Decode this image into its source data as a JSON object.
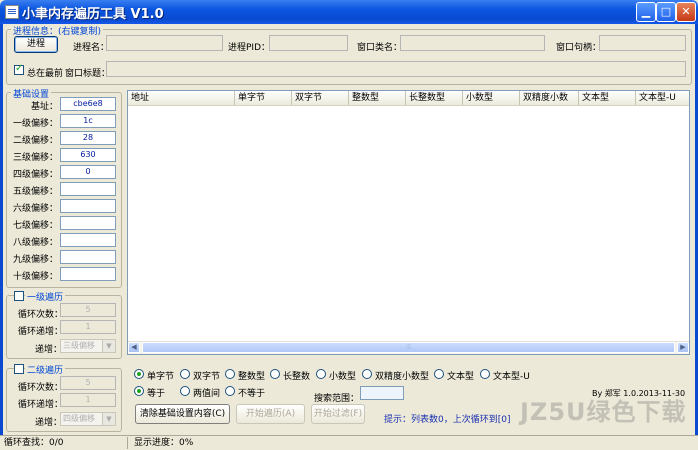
{
  "window": {
    "title": "小聿内存遍历工具  V1.0",
    "min_icon": "minimize-icon",
    "max_icon": "maximize-icon",
    "close_icon": "close-icon"
  },
  "process": {
    "group_label": "进程信息：(右键复制)",
    "process_button": "进程",
    "process_name_label": "进程名：",
    "process_name_value": "",
    "pid_label": "进程PID：",
    "pid_value": "",
    "window_class_label": "窗口类名：",
    "window_class_value": "",
    "window_handle_label": "窗口句柄：",
    "window_handle_value": "",
    "always_on_top_label": "总在最前",
    "always_on_top_checked": true,
    "window_title_label": "窗口标题：",
    "window_title_value": ""
  },
  "base": {
    "group_label": "基础设置",
    "rows": [
      {
        "label": "基址：",
        "value": "cbe6e8"
      },
      {
        "label": "一级偏移：",
        "value": "1c"
      },
      {
        "label": "二级偏移：",
        "value": "28"
      },
      {
        "label": "三级偏移：",
        "value": "630"
      },
      {
        "label": "四级偏移：",
        "value": "0"
      },
      {
        "label": "五级偏移：",
        "value": ""
      },
      {
        "label": "六级偏移：",
        "value": ""
      },
      {
        "label": "七级偏移：",
        "value": ""
      },
      {
        "label": "八级偏移：",
        "value": ""
      },
      {
        "label": "九级偏移：",
        "value": ""
      },
      {
        "label": "十级偏移：",
        "value": ""
      }
    ]
  },
  "loop1": {
    "group_label": "一级遍历",
    "count_label": "循环次数：",
    "count_value": "5",
    "step_label": "循环递增：",
    "step_value": "1",
    "inc_label": "递增：",
    "inc_value": "三级偏移"
  },
  "loop2": {
    "group_label": "二级遍历",
    "count_label": "循环次数：",
    "count_value": "5",
    "step_label": "循环递增：",
    "step_value": "1",
    "inc_label": "递增：",
    "inc_value": "四级偏移"
  },
  "table": {
    "columns": [
      "地址",
      "单字节",
      "双字节",
      "整数型",
      "长整数型",
      "小数型",
      "双精度小数",
      "文本型",
      "文本型-U"
    ]
  },
  "types": {
    "options": [
      "单字节",
      "双字节",
      "整数型",
      "长整数",
      "小数型",
      "双精度小数型",
      "文本型",
      "文本型-U"
    ],
    "selected": 0
  },
  "compare": {
    "options": [
      "等于",
      "两值间",
      "不等于"
    ],
    "selected": 0,
    "search_range_label": "搜索范围：",
    "search_range_value": ""
  },
  "actions": {
    "clear_button": "清除基础设置内容(C)",
    "start_loop_button": "开始遍历(A)",
    "start_filter_button": "开始过滤(F)"
  },
  "hint": "提示：列表数0，上次循环到[0]",
  "version": "By 郑军 1.0.2013-11-30",
  "status": {
    "loop_find": "循环查找：0/0",
    "progress": "显示进度：0%"
  },
  "watermark": "JZ5U绿色下载"
}
